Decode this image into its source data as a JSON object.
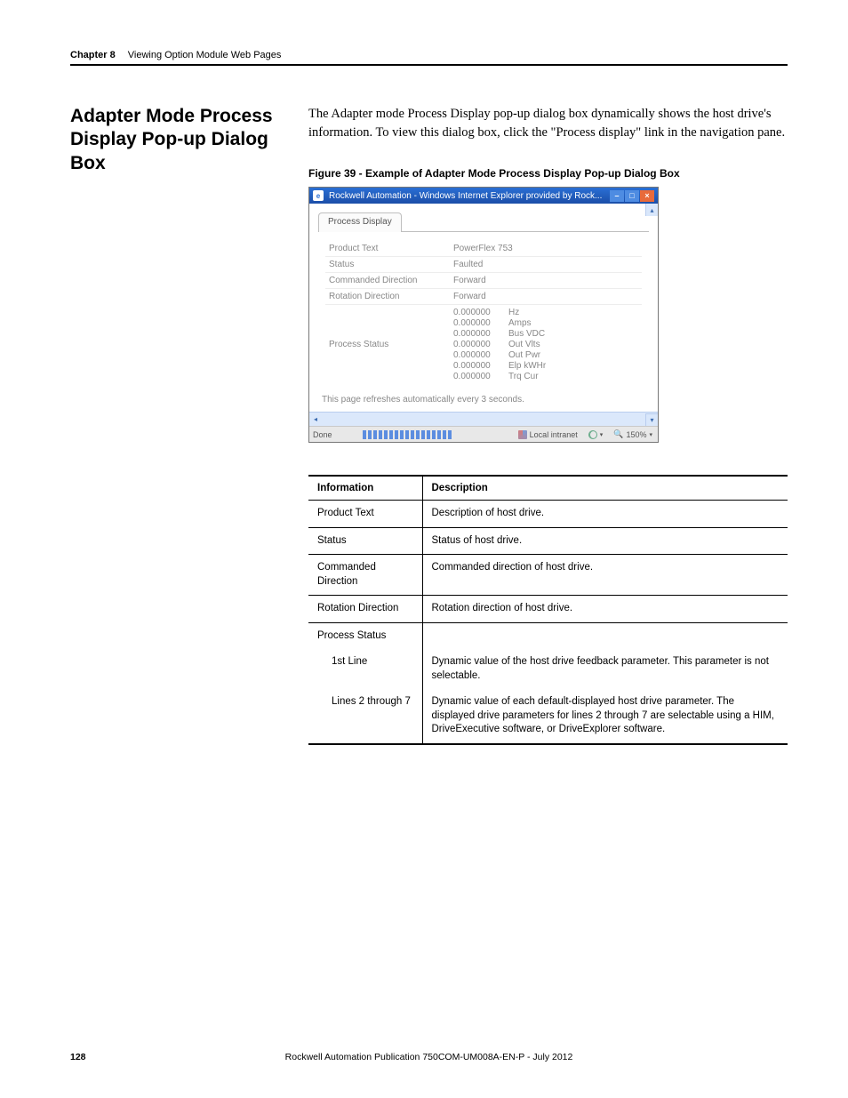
{
  "header": {
    "chapter": "Chapter 8",
    "title": "Viewing Option Module Web Pages"
  },
  "section_title": "Adapter Mode Process Display Pop-up Dialog Box",
  "intro": "The Adapter mode Process Display pop-up dialog box dynamically shows the host drive's information. To view this dialog box, click the \"Process display\" link in the navigation pane.",
  "figure_caption": "Figure 39 - Example of Adapter Mode Process Display Pop-up Dialog Box",
  "ie": {
    "title": "Rockwell Automation - Windows Internet Explorer provided by Rock...",
    "tab": "Process Display",
    "rows": {
      "product_text": {
        "k": "Product Text",
        "v": "PowerFlex 753"
      },
      "status": {
        "k": "Status",
        "v": "Faulted"
      },
      "cmd_dir": {
        "k": "Commanded Direction",
        "v": "Forward"
      },
      "rot_dir": {
        "k": "Rotation Direction",
        "v": "Forward"
      },
      "proc_status": {
        "k": "Process Status"
      }
    },
    "proc_values": [
      {
        "v": "0.000000",
        "u": "Hz"
      },
      {
        "v": "0.000000",
        "u": "Amps"
      },
      {
        "v": "0.000000",
        "u": "Bus VDC"
      },
      {
        "v": "0.000000",
        "u": "Out Vlts"
      },
      {
        "v": "0.000000",
        "u": "Out Pwr"
      },
      {
        "v": "0.000000",
        "u": "Elp kWHr"
      },
      {
        "v": "0.000000",
        "u": "Trq Cur"
      }
    ],
    "refresh_note": "This page refreshes automatically every 3 seconds.",
    "status_done": "Done",
    "status_zone": "Local intranet",
    "status_zoom": "150%"
  },
  "table": {
    "h1": "Information",
    "h2": "Description",
    "r": [
      {
        "k": "Product Text",
        "v": "Description of host drive."
      },
      {
        "k": "Status",
        "v": "Status of host drive."
      },
      {
        "k": "Commanded Direction",
        "v": "Commanded direction of host drive."
      },
      {
        "k": "Rotation Direction",
        "v": "Rotation direction of host drive."
      }
    ],
    "ps": "Process Status",
    "ps1k": "1st Line",
    "ps1v": "Dynamic value of the host drive feedback parameter. This parameter is not selectable.",
    "ps2k": "Lines 2 through 7",
    "ps2v": "Dynamic value of each default-displayed host drive parameter. The displayed drive parameters for lines 2 through 7 are selectable using a HIM, DriveExecutive software, or DriveExplorer software."
  },
  "footer": {
    "page": "128",
    "pub": "Rockwell Automation Publication 750COM-UM008A-EN-P - July 2012"
  }
}
